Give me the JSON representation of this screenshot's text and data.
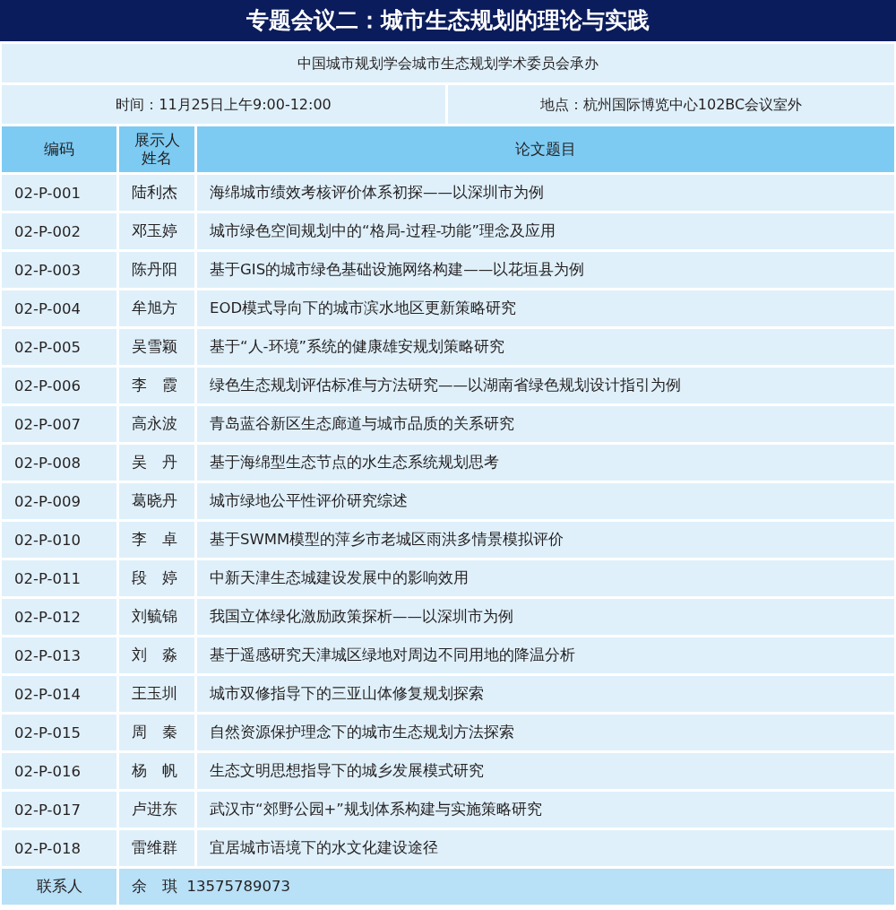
{
  "title": "专题会议二：城市生态规划的理论与实践",
  "organizer": "中国城市规划学会城市生态规划学术委员会承办",
  "time": "时间：11月25日上午9:00-12:00",
  "location": "地点：杭州国际博览中心102BC会议室外",
  "table": {
    "columns": [
      "编码",
      "展示人姓名",
      "论文题目"
    ],
    "rows": [
      [
        "02-P-001",
        "陆利杰",
        "海绵城市绩效考核评价体系初探——以深圳市为例"
      ],
      [
        "02-P-002",
        "邓玉婷",
        "城市绿色空间规划中的“格局-过程-功能”理念及应用"
      ],
      [
        "02-P-003",
        "陈丹阳",
        "基于GIS的城市绿色基础设施网络构建——以花垣县为例"
      ],
      [
        "02-P-004",
        "牟旭方",
        "EOD模式导向下的城市滨水地区更新策略研究"
      ],
      [
        "02-P-005",
        "吴雪颖",
        "基于“人-环境”系统的健康雄安规划策略研究"
      ],
      [
        "02-P-006",
        "李　霞",
        "绿色生态规划评估标准与方法研究——以湖南省绿色规划设计指引为例"
      ],
      [
        "02-P-007",
        "高永波",
        "青岛蓝谷新区生态廊道与城市品质的关系研究"
      ],
      [
        "02-P-008",
        "吴　丹",
        "基于海绵型生态节点的水生态系统规划思考"
      ],
      [
        "02-P-009",
        "葛晓丹",
        "城市绿地公平性评价研究综述"
      ],
      [
        "02-P-010",
        "李　卓",
        "基于SWMM模型的萍乡市老城区雨洪多情景模拟评价"
      ],
      [
        "02-P-011",
        "段　婷",
        "中新天津生态城建设发展中的影响效用"
      ],
      [
        "02-P-012",
        "刘毓锦",
        "我国立体绿化激励政策探析——以深圳市为例"
      ],
      [
        "02-P-013",
        "刘　淼",
        "基于遥感研究天津城区绿地对周边不同用地的降温分析"
      ],
      [
        "02-P-014",
        "王玉圳",
        "城市双修指导下的三亚山体修复规划探索"
      ],
      [
        "02-P-015",
        "周　秦",
        "自然资源保护理念下的城市生态规划方法探索"
      ],
      [
        "02-P-016",
        "杨　帆",
        "生态文明思想指导下的城乡发展模式研究"
      ],
      [
        "02-P-017",
        "卢进东",
        "武汉市“郊野公园+”规划体系构建与实施策略研究"
      ],
      [
        "02-P-018",
        "雷维群",
        "宜居城市语境下的水文化建设途径"
      ]
    ]
  },
  "contact": {
    "label": "联系人",
    "value": "余　琪  13575789073"
  }
}
